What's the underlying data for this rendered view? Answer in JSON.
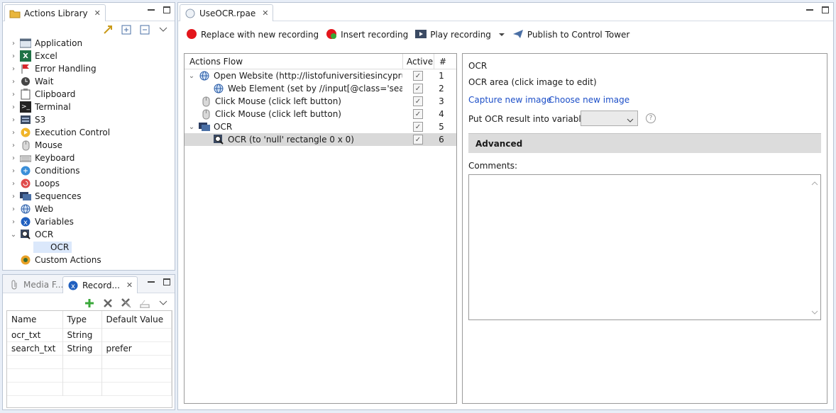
{
  "library": {
    "tab_title": "Actions Library",
    "items": [
      {
        "label": "Application",
        "icon": "application-icon"
      },
      {
        "label": "Excel",
        "icon": "excel-icon"
      },
      {
        "label": "Error Handling",
        "icon": "flag-icon"
      },
      {
        "label": "Wait",
        "icon": "clock-icon"
      },
      {
        "label": "Clipboard",
        "icon": "clipboard-icon"
      },
      {
        "label": "Terminal",
        "icon": "terminal-icon"
      },
      {
        "label": "S3",
        "icon": "s3-icon"
      },
      {
        "label": "Execution Control",
        "icon": "play-circle-icon"
      },
      {
        "label": "Mouse",
        "icon": "mouse-icon"
      },
      {
        "label": "Keyboard",
        "icon": "keyboard-icon"
      },
      {
        "label": "Conditions",
        "icon": "conditions-icon"
      },
      {
        "label": "Loops",
        "icon": "loops-icon"
      },
      {
        "label": "Sequences",
        "icon": "sequences-icon"
      },
      {
        "label": "Web",
        "icon": "globe-icon"
      },
      {
        "label": "Variables",
        "icon": "variables-icon"
      },
      {
        "label": "OCR",
        "icon": "ocr-icon"
      },
      {
        "label": "OCR",
        "icon": ""
      },
      {
        "label": "Custom Actions",
        "icon": "custom-actions-icon"
      }
    ]
  },
  "bottom_panel": {
    "tab_media": "Media F...",
    "tab_record": "Record...",
    "columns": [
      "Name",
      "Type",
      "Default Value"
    ],
    "rows": [
      [
        "ocr_txt",
        "String",
        ""
      ],
      [
        "search_txt",
        "String",
        "prefer"
      ]
    ]
  },
  "editor": {
    "tab_title": "UseOCR.rpae",
    "toolbar": {
      "replace": "Replace with new recording",
      "insert": "Insert recording",
      "play": "Play recording",
      "publish": "Publish to Control Tower"
    },
    "flow": {
      "header_actions": "Actions Flow",
      "header_active": "Active",
      "header_num": "#",
      "rows": [
        {
          "label": "Open Website (http://listofuniversitiesincyprus.com",
          "num": "1",
          "icon": "globe-icon"
        },
        {
          "label": "Web Element (set by //input[@class='search-fi",
          "num": "2",
          "icon": "globe-icon"
        },
        {
          "label": "Click Mouse (click left button)",
          "num": "3",
          "icon": "mouse-icon"
        },
        {
          "label": "Click Mouse (click left button)",
          "num": "4",
          "icon": "mouse-icon"
        },
        {
          "label": "OCR",
          "num": "5",
          "icon": "ocr-group-icon"
        },
        {
          "label": "OCR (to 'null' rectangle 0 x 0)",
          "num": "6",
          "icon": "ocr-icon"
        }
      ]
    },
    "props": {
      "title": "OCR",
      "area_label": "OCR area (click image to edit)",
      "capture_link": "Capture new image",
      "choose_link": "Choose new image",
      "put_result_label": "Put OCR result into variable:",
      "advanced": "Advanced",
      "comments": "Comments:"
    }
  }
}
